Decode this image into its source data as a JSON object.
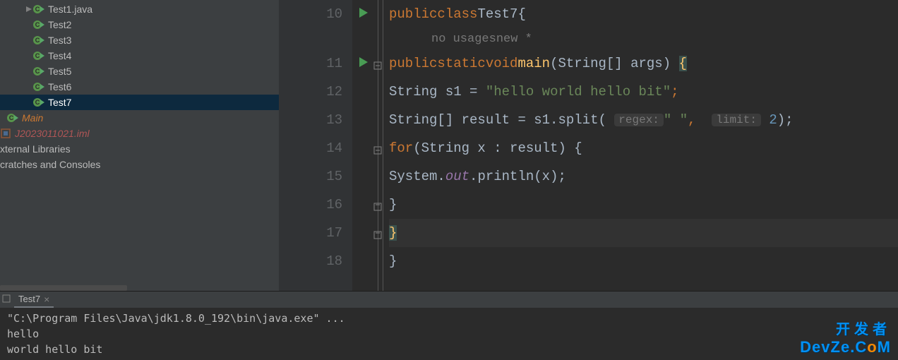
{
  "sidebar": {
    "files": [
      {
        "label": "Test1.java",
        "hasChevron": true
      },
      {
        "label": "Test2"
      },
      {
        "label": "Test3"
      },
      {
        "label": "Test4"
      },
      {
        "label": "Test5"
      },
      {
        "label": "Test6"
      },
      {
        "label": "Test7",
        "selected": true
      }
    ],
    "main_label": "Main",
    "iml_label": "J2023011021.iml",
    "external_libs": "xternal Libraries",
    "scratches": "cratches and Consoles"
  },
  "editor": {
    "line_numbers": [
      "10",
      "11",
      "12",
      "13",
      "14",
      "15",
      "16",
      "17",
      "18"
    ],
    "run_markers": [
      0,
      1
    ],
    "hints": {
      "usages": "no usages",
      "new": "new *"
    },
    "code": {
      "l10": {
        "kw1": "public",
        "kw2": "class",
        "cls": "Test7",
        "brace": "{"
      },
      "l11": {
        "kw1": "public",
        "kw2": "static",
        "kw3": "void",
        "fn": "main",
        "sig1": "(String[] args) ",
        "brace": "{"
      },
      "l12": {
        "type": "String ",
        "var": "s1 ",
        "eq": "= ",
        "str": "\"hello world hello bit\"",
        "semi": ";"
      },
      "l13": {
        "type": "String[] ",
        "var": "result ",
        "eq": "= s1.split( ",
        "hint1": "regex:",
        "arg1": "\" \"",
        "comma": ",  ",
        "hint2": "limit:",
        "arg2": " 2",
        "end": ");"
      },
      "l14": {
        "kw": "for",
        "sig": "(String x : result) {"
      },
      "l15": {
        "pre": "System.",
        "out": "out",
        "call": ".println(x);"
      },
      "l16": {
        "brace": "}"
      },
      "l17": {
        "brace": "}"
      },
      "l18": {
        "brace": "}"
      }
    }
  },
  "console": {
    "tab_label": "Test7",
    "output": [
      "\"C:\\Program Files\\Java\\jdk1.8.0_192\\bin\\java.exe\" ...",
      "hello",
      "world hello bit"
    ]
  },
  "watermark": {
    "cn": "开发者",
    "en_pre": "DevZe.C",
    "en_o": "o",
    "en_post": "M"
  }
}
